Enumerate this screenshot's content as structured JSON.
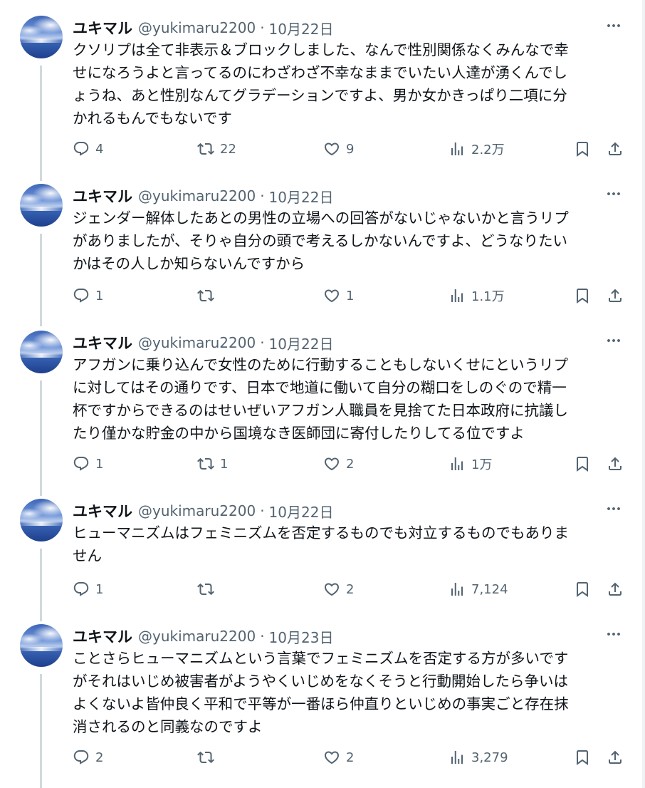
{
  "tweets": [
    {
      "name": "ユキマル",
      "handle": "@yukimaru2200",
      "separator": "·",
      "date": "10月22日",
      "lines": [
        "クソリプは全て非表示＆ブロックしました、なんで性別関係なくみんなで幸",
        "せになろうよと言ってるのにわざわざ不幸なままでいたい人達が湧くんでし",
        "ょうね、あと性別なんてグラデーションですよ、男か女かきっぱり二項に分",
        "かれるもんでもないです"
      ],
      "replies": "4",
      "reposts": "22",
      "likes": "9",
      "views": "2.2万"
    },
    {
      "name": "ユキマル",
      "handle": "@yukimaru2200",
      "separator": "·",
      "date": "10月22日",
      "lines": [
        "ジェンダー解体したあとの男性の立場への回答がないじゃないかと言うリプ",
        "がありましたが、そりゃ自分の頭で考えるしかないんですよ、どうなりたい",
        "かはその人しか知らないんですから"
      ],
      "replies": "1",
      "reposts": "",
      "likes": "1",
      "views": "1.1万"
    },
    {
      "name": "ユキマル",
      "handle": "@yukimaru2200",
      "separator": "·",
      "date": "10月22日",
      "lines": [
        "アフガンに乗り込んで女性のために行動することもしないくせにというリプ",
        "に対してはその通りです、日本で地道に働いて自分の糊口をしのぐので精一",
        "杯ですからできるのはせいぜいアフガン人職員を見捨てた日本政府に抗議し",
        "たり僅かな貯金の中から国境なき医師団に寄付したりしてる位ですよ"
      ],
      "replies": "1",
      "reposts": "1",
      "likes": "2",
      "views": "1万"
    },
    {
      "name": "ユキマル",
      "handle": "@yukimaru2200",
      "separator": "·",
      "date": "10月22日",
      "lines": [
        "ヒューマニズムはフェミニズムを否定するものでも対立するものでもありま",
        "せん"
      ],
      "replies": "1",
      "reposts": "",
      "likes": "2",
      "views": "7,124"
    },
    {
      "name": "ユキマル",
      "handle": "@yukimaru2200",
      "separator": "·",
      "date": "10月23日",
      "lines": [
        "ことさらヒューマニズムという言葉でフェミニズムを否定する方が多いです",
        "がそれはいじめ被害者がようやくいじめをなくそうと行動開始したら争いは",
        "よくないよ皆仲良く平和で平等が一番ほら仲直りといじめの事実ごと存在抹",
        "消されるのと同義なのですよ"
      ],
      "replies": "2",
      "reposts": "",
      "likes": "2",
      "views": "3,279"
    }
  ],
  "icons": {
    "reply": "reply-icon",
    "repost": "repost-icon",
    "like": "heart-icon",
    "views": "views-icon",
    "bookmark": "bookmark-icon",
    "share": "share-icon",
    "more": "more-icon"
  },
  "colors": {
    "text": "#0f1419",
    "secondary": "#536471",
    "thread_line": "#cfd9de"
  }
}
